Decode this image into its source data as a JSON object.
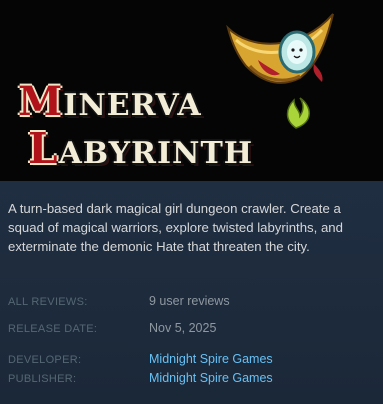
{
  "header_image": {
    "title_line1": {
      "initial": "M",
      "rest": "INERVA"
    },
    "title_line2": {
      "initial": "L",
      "rest": "ABYRINTH"
    }
  },
  "description": "A turn-based dark magical girl dungeon crawler. Create a squad of magical warriors, explore twisted labyrinths, and exterminate the demonic Hate that threaten the city.",
  "reviews": {
    "label": "ALL REVIEWS:",
    "value": "9 user reviews"
  },
  "release": {
    "label": "RELEASE DATE:",
    "value": "Nov 5, 2025"
  },
  "developer": {
    "label": "DEVELOPER:",
    "value": "Midnight Spire Games"
  },
  "publisher": {
    "label": "PUBLISHER:",
    "value": "Midnight Spire Games"
  },
  "colors": {
    "background": "#1b2838",
    "link": "#66c0f4",
    "label": "#556772",
    "value": "#8f98a0",
    "description": "#d6d7d8"
  }
}
